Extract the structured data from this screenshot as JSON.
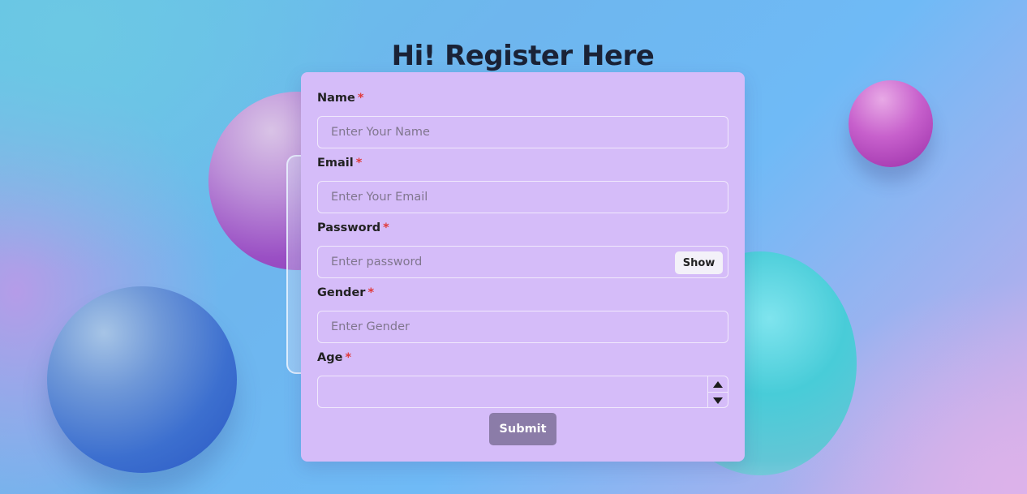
{
  "page": {
    "title": "Hi! Register Here",
    "background_colors": [
      "#66c4e6",
      "#6fbaf6",
      "#d6aee8"
    ],
    "card_color": "#d5bcf9"
  },
  "form": {
    "required_marker": "*",
    "required_color": "#e03a3a",
    "fields": [
      {
        "label": "Name",
        "placeholder": "Enter Your Name",
        "value": ""
      },
      {
        "label": "Email",
        "placeholder": "Enter Your Email",
        "value": ""
      },
      {
        "label": "Password",
        "placeholder": "Enter password",
        "value": "",
        "toggle_label": "Show"
      },
      {
        "label": "Gender",
        "placeholder": "Enter Gender",
        "value": ""
      },
      {
        "label": "Age",
        "placeholder": "",
        "value": "",
        "spinner_icons": [
          "triangle-up-icon",
          "triangle-down-icon"
        ]
      }
    ],
    "submit_label": "Submit",
    "submit_color": "#8b7ca8"
  }
}
